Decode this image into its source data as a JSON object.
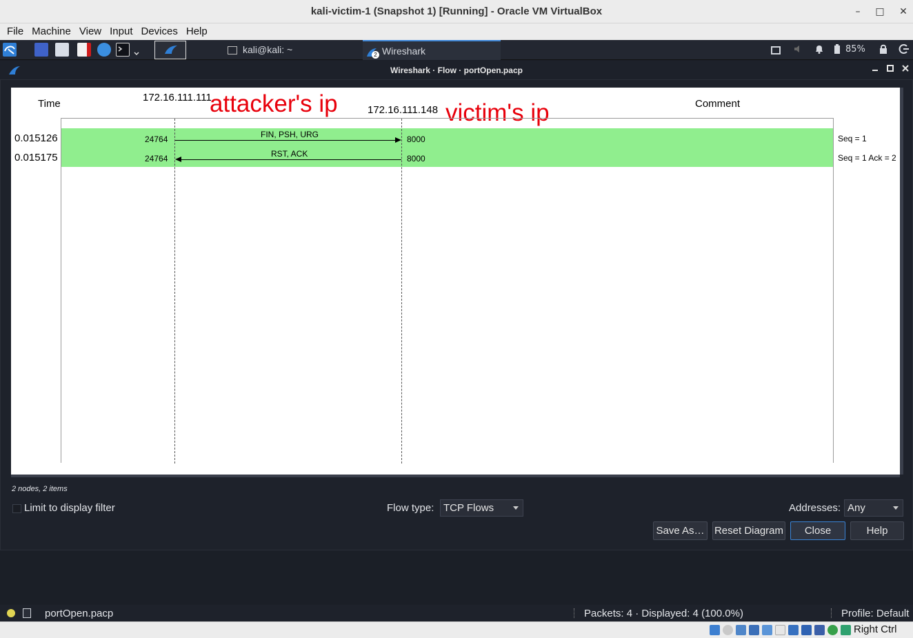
{
  "host_window": {
    "title": "kali-victim-1 (Snapshot 1) [Running] - Oracle VM VirtualBox",
    "menu": [
      "File",
      "Machine",
      "View",
      "Input",
      "Devices",
      "Help"
    ],
    "minimize": "–",
    "maximize": "□",
    "close": "✕"
  },
  "kali_panel": {
    "tasks": [
      {
        "label": "kali@kali: ~"
      },
      {
        "label": "Wireshark",
        "badge": "2"
      }
    ],
    "battery": "85%"
  },
  "dialog": {
    "title": "Wireshark · Flow · portOpen.pacp",
    "header": {
      "time": "Time",
      "node_a": "172.16.111.111",
      "node_b": "172.16.111.148",
      "comment": "Comment"
    },
    "annotations": {
      "attacker": "attacker's ip",
      "victim": "victim's ip"
    },
    "rows": [
      {
        "time": "0.015126",
        "label": "FIN, PSH, URG",
        "port_a": "24764",
        "port_b": "8000",
        "comment": "Seq = 1",
        "direction": "right"
      },
      {
        "time": "0.015175",
        "label": "RST, ACK",
        "port_a": "24764",
        "port_b": "8000",
        "comment": "Seq = 1 Ack = 2",
        "direction": "left"
      }
    ],
    "summary": "2 nodes, 2 items",
    "limit_filter_label": "Limit to display filter",
    "flow_type_label": "Flow type:",
    "flow_type_value": "TCP Flows",
    "addresses_label": "Addresses:",
    "addresses_value": "Any",
    "buttons": {
      "save_as": "Save As…",
      "reset": "Reset Diagram",
      "close": "Close",
      "help": "Help"
    }
  },
  "statusbar": {
    "file": "portOpen.pacp",
    "packets": "Packets: 4 · Displayed: 4 (100.0%)",
    "profile": "Profile: Default"
  },
  "vbox_status": {
    "host_key": "Right Ctrl"
  },
  "colors": {
    "row_bg": "#90ee8e",
    "annotation": "#e8000b",
    "accent": "#3b84d6"
  }
}
